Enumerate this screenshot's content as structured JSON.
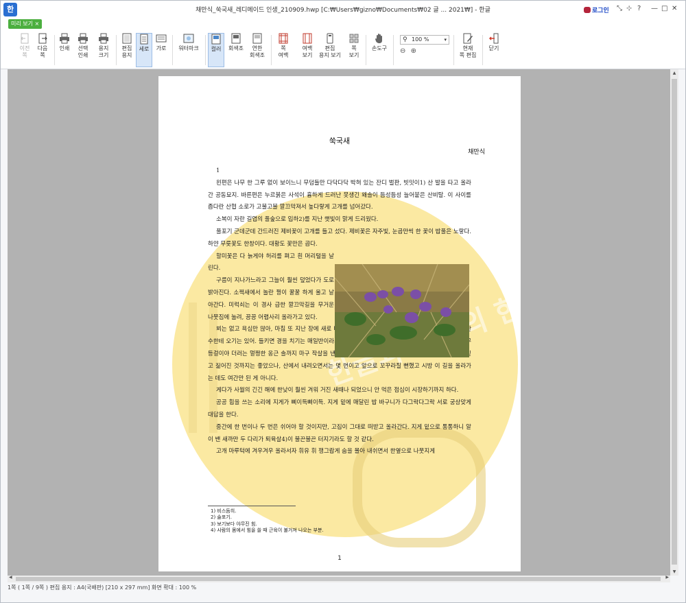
{
  "window": {
    "title": "채만식_쑥국새_레디메이드 인생_210909.hwp [C:₩Users₩gizno₩Documents₩02 글 ... 2021₩] - 한글",
    "login_label": "로그인",
    "app_icon": "한",
    "controls": [
      "⤡",
      "⊹",
      "?",
      "—",
      "□",
      "✕"
    ]
  },
  "preview_tab": {
    "label": "미리 보기",
    "close": "×"
  },
  "toolbar": {
    "prev_page": "이전\n쪽",
    "next_page": "다음\n쪽",
    "print": "인쇄",
    "select_print": "선택\n인쇄",
    "paper_size": "용지\n크기",
    "edit_paper": "편집\n용지",
    "portrait": "세로",
    "landscape": "가로",
    "watermark": "워터마크",
    "color": "컬러",
    "grayscale": "회색조",
    "light_grayscale": "연한\n회색조",
    "margin": "쪽\n여백",
    "margin_view": "여백\n보기",
    "edit_paper_view": "편집\n용지 보기",
    "page_view": "쪽\n보기",
    "hand_tool": "손도구",
    "zoom_value": "100 %",
    "current_page_edit": "현재\n쪽 편집",
    "close": "닫기"
  },
  "document": {
    "title": "쑥국새",
    "author": "채만식",
    "section": "1",
    "paragraphs": [
      "왼편은 나무 한 그루 없이 보이느니 무덤들만 다닥다닥 박혀 있는 잔디 벌판, 빗밋이1) 산 발을 타고 올라간 공동묘지. 바른편은 누르붉은 사석이 흉하게 드러난 못생긴 왜솔이 듬성듬성 늘어붙은 산비탈. 이 사이를 좁다란 산협 소로가 고불고불 깔끄막져서 높다랗게 고개를 넘어갔다.",
      "소복이 자란 길엽의 풀숲으로 입하2)를 지난 햇빛이 맑게 드리웠다.",
      "풀포기 군데군데 간드러진 제비꽃이 고개를 들고 섰다. 제비꽃은 자주빛, 눈곱만씩 한 꽃이 밥풀은 노랗다. 하얀 무릇꽃도 한창이다. 대황도 꽃만은 곱다.",
      "할미꽃은 다 늙게야 허리를 펴고 흰 머리털을 날린다.",
      "구름이 지나가느라고 그늘이 훨씬 덮었다가 도로 밝아진다. 소쩍새에서 놀란 꿩이 꿀꿀 하게 울고 날아간다. 미럭쇠는 이 경사 급한 깔끄막길을 무거운 나뭇짐에 눌려, 끙끙 어렵사리 올라가고 있다.",
      "뵈는 없고 욕심만 많아, 마침 또 지난 장에 새로 벼려온 곡괭이가 알심3) 있이 손에 맞겠다. 한데 산림 간수한테 오기는 있어. 들키면 경을 치기는 매일반이라서 들이치는 대로 철쭉 등걸이야 진달래 등걸이야 소나무 등걸이야 더러는 멀쩡한 옹근 솔까지 마구 작살을 낸 것이. 해놓고 보니 필경 짐에 넘치는 것을 제 기운만 믿고 짊어진 것까지는 좋았으나, 산에서 내려오면서는 몇 번이고 앞으로 꼬꾸라질 뻔했고 시방 이 길을 올라가는 데도 여간만 된 게 아니다.",
      "게다가 사월의 긴긴 해에 한낮이 훨씬 겨워 거진 새때나 되었으니 안 먹은 점심이 시장하기까지 하다.",
      "공공 힘을 쓰는 소리에 지게가 삐이득삐이득. 지게 밑에 매달린 밥 바구니가 다그락다그락 서로 궁상맞게 대답을 한다.",
      "중간에 한 번이나 두 번은 쉬어야 할 것이지만, 고집이 그대로 떠받고 올라간다. 지게 밑으로 통통하니 알이 밴 새까만 두 다리가 퇴육살4)이 불끈불끈 터지기라도 할 것 같다.",
      "고개 마루턱에 겨우겨우 올라서자 휘유 휘 쟁그랍게 숨을 몰아 내쉬면서 한옆으로 나뭇지게"
    ],
    "footnotes": [
      "1) 비스듬히.",
      "2) 술포기.",
      "3) 보기보다 야무진 힘.",
      "4) 사람의 몸에서 힘을 쓸 때 근육이 불거져 나오는 부분."
    ],
    "page_number": "1",
    "watermark_text": "한글과 함께의 한글 2020 실습"
  },
  "status_bar": "1쪽 ( 1쪽 / 9쪽 )  편집 용지 : A4(국배판)  [210 x 297 mm]  화면 확대 : 100 %",
  "colors": {
    "accent": "#2a6fd1",
    "preview_tab": "#4caf3f",
    "watermark": "#f7df7a",
    "background": "#b2b2b2"
  }
}
